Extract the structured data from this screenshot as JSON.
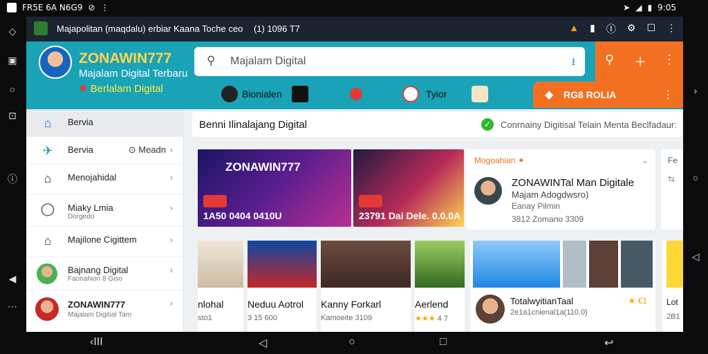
{
  "status": {
    "left_text": "FR5E 6A N6G9",
    "right_text": "9:05"
  },
  "appbar": {
    "title": "Majapolitan (maqdalu) erbiar Kaana Toche ceo",
    "counter": "(1) 1096 T7"
  },
  "header": {
    "brand": "ZONAWIN777",
    "tagline1": "Majalam Digital Terbaru",
    "tagline2": "Berlalam Digital",
    "search_placeholder": "Majalam Digital",
    "chips": [
      "Bionialen",
      "Tyior"
    ],
    "promo_label": "RG8 ROLIA"
  },
  "sidebar": {
    "items": [
      {
        "label": "Bervia",
        "icon": "home-icon"
      },
      {
        "label": "Bervia",
        "extra": "Meadn",
        "icon": "telegram-icon"
      },
      {
        "label": "Menojahidal",
        "icon": "house-outline-icon"
      },
      {
        "label": "Miaky Lmia",
        "sub": "Dorgedo",
        "icon": "chat-bubble-icon"
      },
      {
        "label": "Majilone Cigittem",
        "icon": "house-grid-icon"
      },
      {
        "label": "Bajnang Digital",
        "sub": "Faonahion 8 Giso",
        "icon": "avatar"
      },
      {
        "label": "ZONAWIN777",
        "sub": "Majalam Digitial Tam",
        "icon": "avatar"
      }
    ]
  },
  "main": {
    "breadcrumb": "Benni Ilinalajang Digital",
    "verified_text": "Conrnainy Digitisal Telain Menta Beclfadaur:",
    "banners": [
      {
        "title": "ZONAWIN777",
        "caption": "1A50 0404 0410U"
      },
      {
        "caption": "23791 Dai Dele. 0.0.0A"
      }
    ],
    "sidecard": {
      "heading": "Mogoahian",
      "name": "ZONAWINTal Man Digitale",
      "line2": "Majam Adogdwsro)",
      "line3": "Eanay Pilmin",
      "line4": "3812 Zomano 3309"
    },
    "rightstrip_label": "Fe",
    "videos": [
      {
        "title": "nlohal",
        "meta": "sto1"
      },
      {
        "title": "Neduu Aotrol",
        "meta": "3 15 600"
      },
      {
        "title": "Kanny Forkarl",
        "meta": "Kamoeite 3109"
      },
      {
        "title": "Aerlend",
        "meta": "4 7"
      }
    ],
    "gallery": {
      "title": "TotalwyitianTaal",
      "meta": "2e1a1cnienal1a(110.0)",
      "rating": "★ €1"
    },
    "right_video": {
      "title": "Lot",
      "meta": "2B1"
    }
  }
}
